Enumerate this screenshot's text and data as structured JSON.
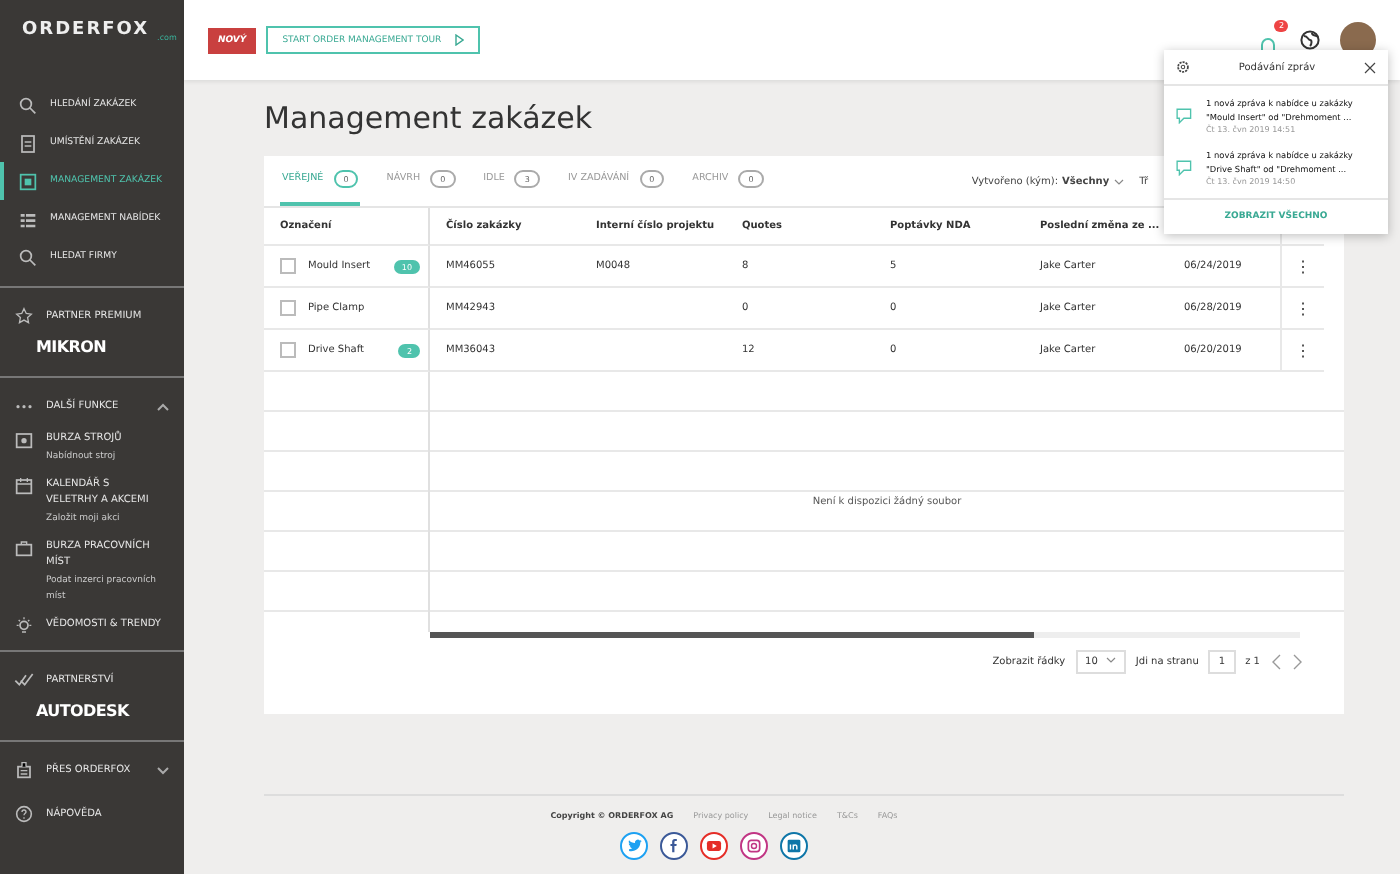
{
  "logo": {
    "name": "ORDERFOX",
    "suffix": ".com"
  },
  "sidebar": {
    "nav": [
      {
        "label": "HLEDÁNÍ ZAKÁZEK",
        "kind": "search",
        "selected": false
      },
      {
        "label": "UMÍSTĚNÍ ZAKÁZEK",
        "kind": "doc",
        "selected": false
      },
      {
        "label": "MANAGEMENT ZAKÁZEK",
        "kind": "board",
        "selected": true
      },
      {
        "label": "MANAGEMENT NABÍDEK",
        "kind": "list",
        "selected": false
      },
      {
        "label": "HLEDAT FIRMY",
        "kind": "search",
        "selected": false
      }
    ],
    "partner_premium": {
      "label": "PARTNER PREMIUM",
      "logo": "MIKRON"
    },
    "more": {
      "label": "DALŠÍ FUNKCE",
      "expanded": true,
      "items": [
        {
          "label": "BURZA STROJŮ",
          "kind": "machine",
          "sub": "Nabídnout stroj"
        },
        {
          "label": "KALENDÁŘ S VELETRHY A AKCEMI",
          "kind": "calendar",
          "sub": "Založit moji akci"
        },
        {
          "label": "BURZA PRACOVNÍCH MÍST",
          "kind": "briefcase",
          "sub": "Podat inzerci pracovních míst"
        },
        {
          "label": "VĚDOMOSTI & TRENDY",
          "kind": "bulb"
        }
      ]
    },
    "partnership": {
      "label": "PARTNERSTVÍ",
      "logo": "AUTODESK"
    },
    "about": {
      "label": "PŘES ORDERFOX",
      "expanded": false
    },
    "help": {
      "label": "NÁPOVĚDA"
    }
  },
  "topbar": {
    "new_badge": "NOVÝ",
    "tour_button": "START ORDER MANAGEMENT TOUR",
    "bell_count": "2"
  },
  "page_title": "Management zakázek",
  "tabs": [
    {
      "label": "VEŘEJNÉ",
      "count": "0",
      "selected": true
    },
    {
      "label": "NÁVRH",
      "count": "0",
      "selected": false
    },
    {
      "label": "IDLE",
      "count": "3",
      "selected": false
    },
    {
      "label": "IV ZADÁVÁNÍ",
      "count": "0",
      "selected": false
    },
    {
      "label": "ARCHIV",
      "count": "0",
      "selected": false
    }
  ],
  "filter": {
    "label": "Vytvořeno (kým):",
    "value": "Všechny",
    "next": "Tř"
  },
  "table": {
    "columns": [
      "Označení",
      "Číslo zakázky",
      "Interní číslo projektu",
      "Quotes",
      "Poptávky NDA",
      "Poslední změna ze ..."
    ],
    "rows": [
      {
        "checked": false,
        "badge": "10",
        "cells": [
          "Mould Insert",
          "MM46055",
          "M0048",
          "8",
          "5",
          "Jake Carter",
          "06/24/2019"
        ],
        "menu": "⋮"
      },
      {
        "checked": false,
        "cells": [
          "Pipe Clamp",
          "MM42943",
          "",
          "0",
          "0",
          "Jake Carter",
          "06/28/2019"
        ],
        "menu": "⋮"
      },
      {
        "checked": false,
        "badge": "2",
        "cells": [
          "Drive Shaft",
          "MM36043",
          "",
          "12",
          "0",
          "Jake Carter",
          "06/20/2019"
        ],
        "menu": "⋮"
      }
    ],
    "empty_message": "Není k dispozici žádný soubor"
  },
  "pagination": {
    "rows_label": "Zobrazit řádky",
    "rows_value": "10",
    "page_label": "Jdi na stranu",
    "page_value": "1",
    "total": "z 1"
  },
  "notifications": {
    "title": "Podávání zpráv",
    "items": [
      {
        "text": "1 nová zpráva k nabídce u zakázky \"Mould Insert\" od \"Drehmoment ...",
        "time": "Čt 13. čvn 2019 14:51"
      },
      {
        "text": "1 nová zpráva k nabídce u zakázky \"Drive Shaft\" od \"Drehmoment ...",
        "time": "Čt 13. čvn 2019 14:50"
      }
    ],
    "show_all": "ZOBRAZIT VŠECHNO"
  },
  "footer": {
    "copyright": "Copyright © ORDERFOX AG",
    "links": [
      "Privacy policy",
      "Legal notice",
      "T&Cs",
      "FAQs"
    ],
    "social": [
      {
        "kind": "twitter",
        "color": "#1da1f2"
      },
      {
        "kind": "facebook",
        "color": "#3b5998"
      },
      {
        "kind": "youtube",
        "color": "#e52d27"
      },
      {
        "kind": "instagram",
        "color": "#c13584"
      },
      {
        "kind": "linkedin",
        "color": "#0e76a8"
      }
    ]
  }
}
